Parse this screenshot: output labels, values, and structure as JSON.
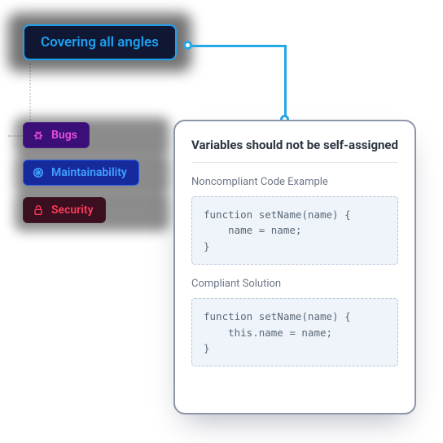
{
  "header": {
    "title": "Covering all angles"
  },
  "categories": [
    {
      "id": "bugs",
      "label": "Bugs",
      "icon": "bug-icon",
      "color": "#e84fe2"
    },
    {
      "id": "maintainability",
      "label": "Maintainability",
      "icon": "maintainability-icon",
      "color": "#3fa2ff"
    },
    {
      "id": "security",
      "label": "Security",
      "icon": "lock-icon",
      "color": "#ff3b5c"
    }
  ],
  "card": {
    "title": "Variables should not be self-assigned",
    "noncompliant": {
      "label": "Noncompliant Code Example",
      "code": "function setName(name) {\n    name = name;\n}"
    },
    "compliant": {
      "label": "Compliant Solution",
      "code": "function setName(name) {\n    this.name = name;\n}"
    }
  },
  "colors": {
    "accent": "#1ea0f0",
    "connector": "#28a7e6"
  }
}
